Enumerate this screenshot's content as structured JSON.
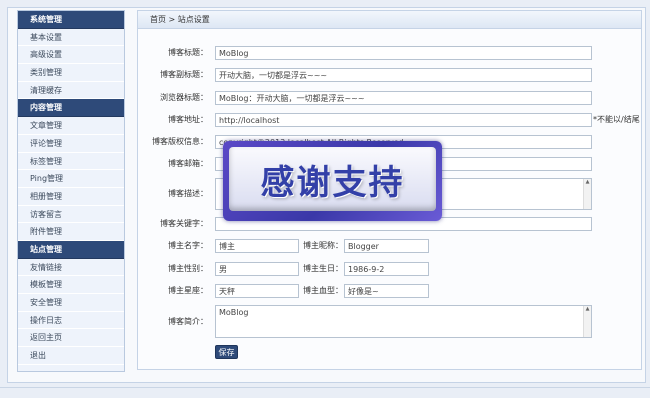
{
  "sidebar": {
    "sections": [
      {
        "title": "系统管理",
        "items": [
          "基本设置",
          "高级设置",
          "类别管理",
          "清理缓存"
        ]
      },
      {
        "title": "内容管理",
        "items": [
          "文章管理",
          "评论管理",
          "标签管理",
          "Ping管理",
          "相册管理",
          "访客留言",
          "附件管理"
        ]
      },
      {
        "title": "站点管理",
        "items": [
          "友情链接",
          "模板管理",
          "安全管理",
          "操作日志",
          "返回主页",
          "退出"
        ]
      }
    ]
  },
  "breadcrumb": "首页 > 站点设置",
  "form": {
    "blog_title_label": "博客标题：",
    "blog_title_value": "MoBlog",
    "blog_subtitle_label": "博客副标题：",
    "blog_subtitle_value": "开动大脑，一切都是浮云~~~",
    "browser_title_label": "浏览器标题：",
    "browser_title_value": "MoBlog：开动大脑，一切都是浮云~~~",
    "blog_url_label": "博客地址：",
    "blog_url_value": "http://localhost",
    "blog_url_note": "*不能以/结尾",
    "copyright_label": "博客版权信息：",
    "copyright_value": "copyright©2013 localhost All Rights Reserved",
    "email_label": "博客邮箱：",
    "email_value": "",
    "description_label": "博客描述：",
    "description_value": "",
    "keywords_label": "博客关键字：",
    "keywords_value": "",
    "owner_name_label": "博主名字：",
    "owner_name_value": "博主",
    "owner_nick_label": "博主昵称：",
    "owner_nick_value": "Blogger",
    "owner_gender_label": "博主性别：",
    "owner_gender_value": "男",
    "owner_birthday_label": "博主生日：",
    "owner_birthday_value": "1986-9-2",
    "owner_zodiac_label": "博主星座：",
    "owner_zodiac_value": "天秤",
    "owner_blood_label": "博主血型：",
    "owner_blood_value": "好像是~",
    "intro_label": "博客简介：",
    "intro_value": "MoBlog",
    "save_label": "保存"
  },
  "overlay": {
    "text": "感谢支持"
  },
  "colors": {
    "sidebar_header": "#2e4a79",
    "save_button": "#2e4a79",
    "overlay_text": "#3340a8"
  }
}
